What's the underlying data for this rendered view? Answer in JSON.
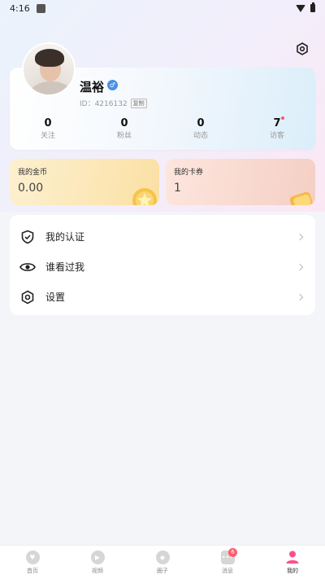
{
  "status_bar": {
    "time": "4:16"
  },
  "profile": {
    "name": "温裕",
    "gender_icon": "male-icon",
    "id_label": "ID：4216132",
    "copy_label": "复制"
  },
  "stats": [
    {
      "count": "0",
      "label": "关注"
    },
    {
      "count": "0",
      "label": "粉丝"
    },
    {
      "count": "0",
      "label": "动态"
    },
    {
      "count": "7",
      "label": "访客"
    }
  ],
  "wallet": {
    "coins": {
      "title": "我的金币",
      "value": "0.00"
    },
    "vouchers": {
      "title": "我的卡券",
      "value": "1"
    }
  },
  "menu": [
    {
      "label": "我的认证",
      "icon": "shield-check-icon"
    },
    {
      "label": "谁看过我",
      "icon": "eye-icon"
    },
    {
      "label": "设置",
      "icon": "settings-icon"
    }
  ],
  "tabs": [
    {
      "label": "首页",
      "icon": "home-icon"
    },
    {
      "label": "视频",
      "icon": "video-icon"
    },
    {
      "label": "圈子",
      "icon": "compass-icon"
    },
    {
      "label": "消息",
      "icon": "message-icon",
      "badge": "6"
    },
    {
      "label": "我的",
      "icon": "user-icon",
      "active": true
    }
  ],
  "colors": {
    "accent_pink": "#ff4f8b",
    "badge_red": "#ff5a6e",
    "gender_blue": "#4a90e2"
  }
}
